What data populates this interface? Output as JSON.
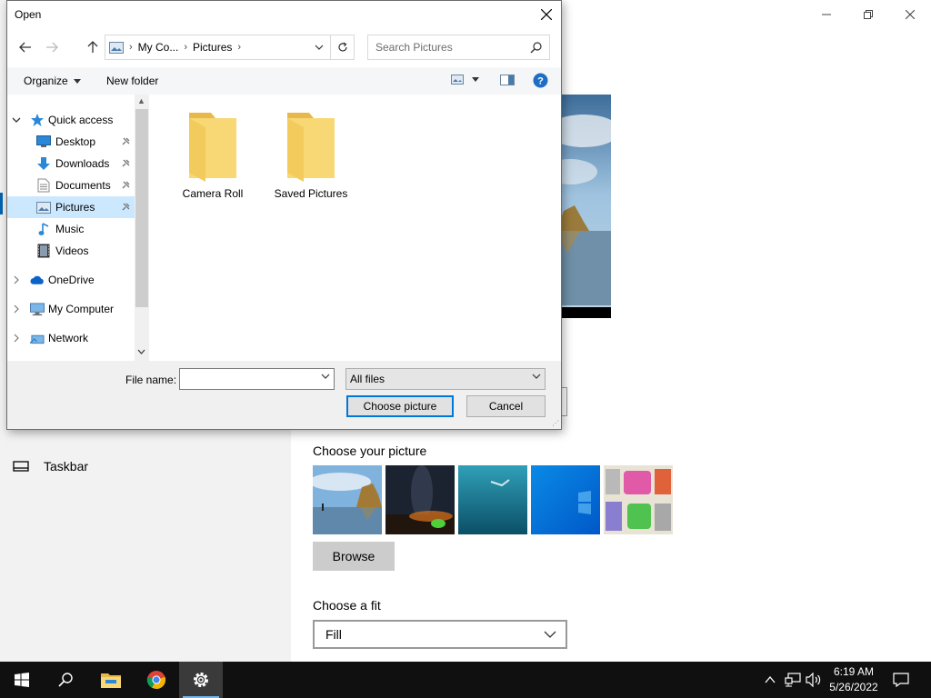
{
  "settings": {
    "nav_taskbar_label": "Taskbar",
    "choose_picture_title": "Choose your picture",
    "browse_label": "Browse",
    "choose_fit_title": "Choose a fit",
    "fit_value": "Fill",
    "thumbnails": [
      "beach-rock",
      "night-sky",
      "underwater-swimmer",
      "windows-blue",
      "cartoon-characters"
    ]
  },
  "dialog": {
    "title": "Open",
    "address": {
      "segments": [
        "My Co...",
        "Pictures"
      ]
    },
    "search_placeholder": "Search Pictures",
    "organize_label": "Organize",
    "new_folder_label": "New folder",
    "nav_tree": [
      {
        "label": "Quick access",
        "icon": "star-icon",
        "expanded": true
      },
      {
        "label": "Desktop",
        "icon": "desktop-icon",
        "pinned": true
      },
      {
        "label": "Downloads",
        "icon": "download-icon",
        "pinned": true
      },
      {
        "label": "Documents",
        "icon": "document-icon",
        "pinned": true
      },
      {
        "label": "Pictures",
        "icon": "pictures-icon",
        "pinned": true,
        "selected": true
      },
      {
        "label": "Music",
        "icon": "music-icon"
      },
      {
        "label": "Videos",
        "icon": "video-icon"
      },
      {
        "label": "OneDrive",
        "icon": "cloud-icon"
      },
      {
        "label": "My Computer",
        "icon": "computer-icon"
      },
      {
        "label": "Network",
        "icon": "network-icon"
      }
    ],
    "folders": [
      "Camera Roll",
      "Saved Pictures"
    ],
    "file_name_label": "File name:",
    "file_name_value": "",
    "file_type": "All files",
    "choose_label": "Choose picture",
    "cancel_label": "Cancel"
  },
  "taskbar": {
    "time": "6:19 AM",
    "date": "5/26/2022",
    "apps": [
      "start-icon",
      "search-icon",
      "file-explorer-icon",
      "chrome-icon",
      "settings-icon"
    ]
  },
  "colors": {
    "accent": "#0078d7",
    "selection": "#cce8ff",
    "folder": "#f8d775",
    "taskbar": "#101010"
  }
}
